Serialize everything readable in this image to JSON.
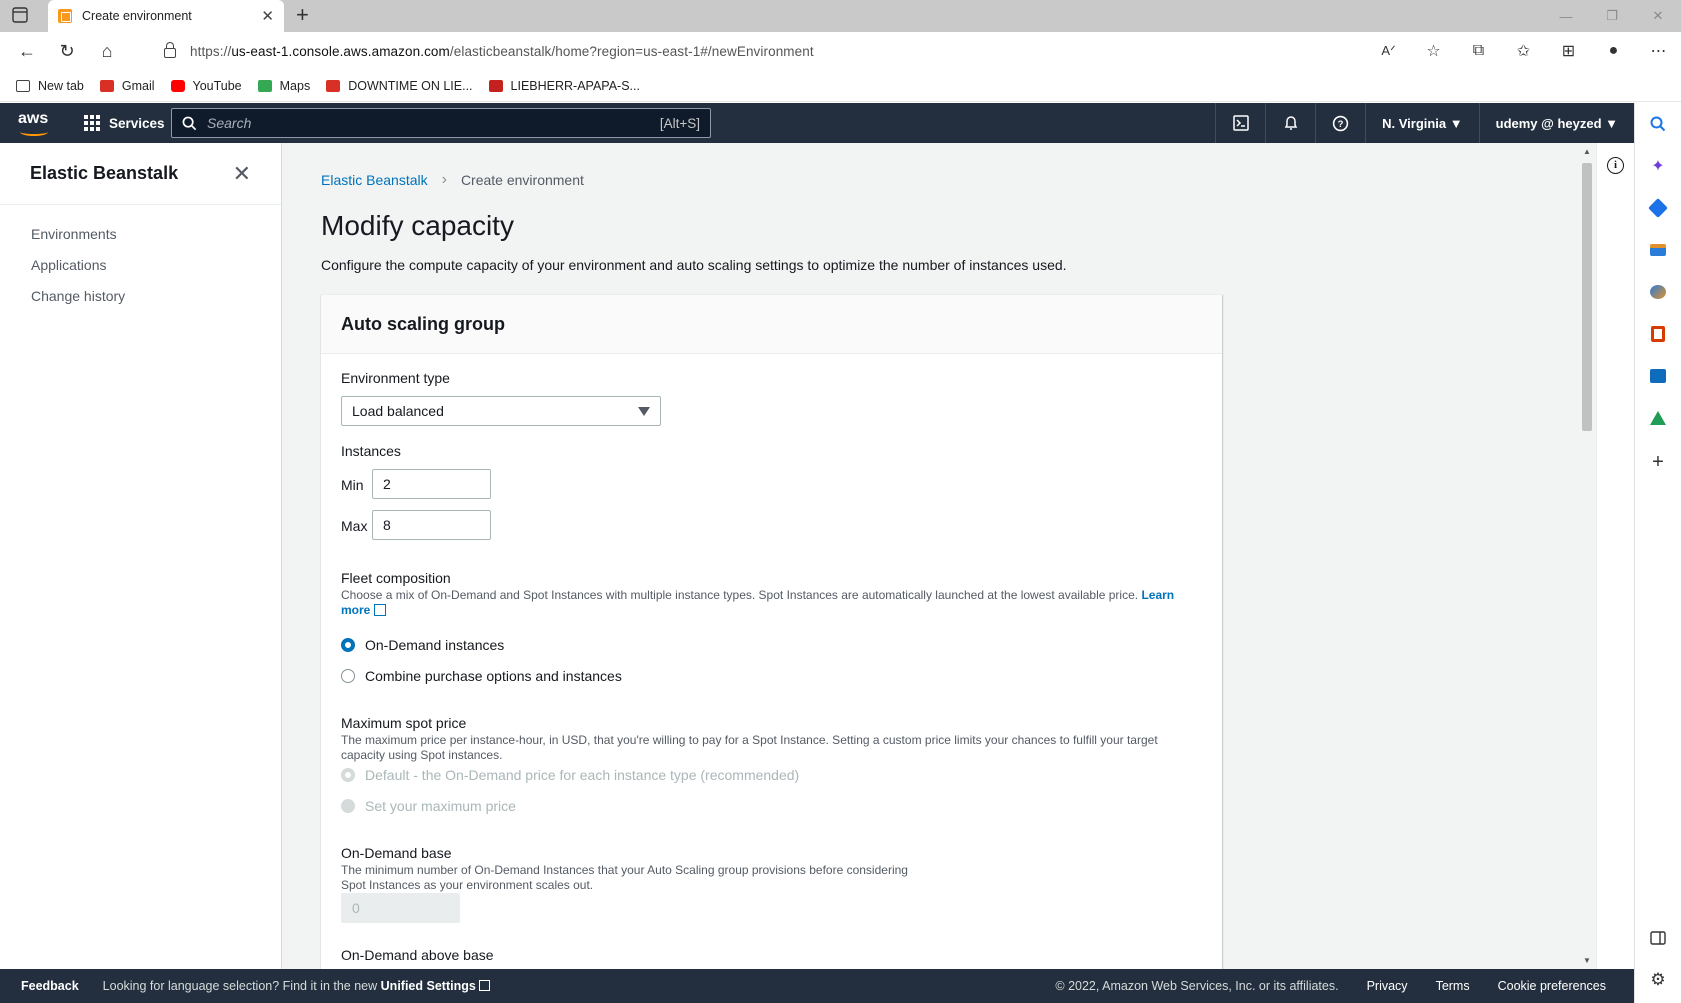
{
  "browser": {
    "tab_title": "Create environment",
    "url_prefix": "https://",
    "url_host": "us-east-1.console.aws.amazon.com",
    "url_path": "/elasticbeanstalk/home?region=us-east-1#/newEnvironment",
    "bookmarks": [
      {
        "label": "New tab",
        "color": "#444444"
      },
      {
        "label": "Gmail",
        "color": "#d93025"
      },
      {
        "label": "YouTube",
        "color": "#ff0000"
      },
      {
        "label": "Maps",
        "color": "#34a853"
      },
      {
        "label": "DOWNTIME ON LIE...",
        "color": "#d93025"
      },
      {
        "label": "LIEBHERR-APAPA-S...",
        "color": "#c5221f"
      }
    ]
  },
  "aws_nav": {
    "logo": "aws",
    "services_label": "Services",
    "search_placeholder": "Search",
    "search_shortcut": "[Alt+S]",
    "region": "N. Virginia ▼",
    "account": "udemy @ heyzed ▼"
  },
  "sidenav": {
    "title": "Elastic Beanstalk",
    "items": [
      "Environments",
      "Applications",
      "Change history"
    ]
  },
  "breadcrumb": {
    "parent": "Elastic Beanstalk",
    "current": "Create environment"
  },
  "page": {
    "title": "Modify capacity",
    "description": "Configure the compute capacity of your environment and auto scaling settings to optimize the number of instances used."
  },
  "asg": {
    "title": "Auto scaling group",
    "env_type_label": "Environment type",
    "env_type_value": "Load balanced",
    "instances_label": "Instances",
    "min_label": "Min",
    "min_value": "2",
    "max_label": "Max",
    "max_value": "8",
    "fleet_label": "Fleet composition",
    "fleet_desc": "Choose a mix of On-Demand and Spot Instances with multiple instance types. Spot Instances are automatically launched at the lowest available price.",
    "learn_more": "Learn more",
    "fleet_options": [
      "On-Demand instances",
      "Combine purchase options and instances"
    ],
    "spot_label": "Maximum spot price",
    "spot_desc": "The maximum price per instance-hour, in USD, that you're willing to pay for a Spot Instance. Setting a custom price limits your chances to fulfill your target capacity using Spot instances.",
    "spot_options": [
      "Default - the On-Demand price for each instance type (recommended)",
      "Set your maximum price"
    ],
    "od_base_label": "On-Demand base",
    "od_base_desc": "The minimum number of On-Demand Instances that your Auto Scaling group provisions before considering Spot Instances as your environment scales out.",
    "od_base_value": "0",
    "od_above_label": "On-Demand above base"
  },
  "footer": {
    "feedback": "Feedback",
    "language_msg": "Looking for language selection? Find it in the new",
    "unified_settings": "Unified Settings",
    "copyright": "© 2022, Amazon Web Services, Inc. or its affiliates.",
    "privacy": "Privacy",
    "terms": "Terms",
    "cookie": "Cookie preferences"
  },
  "colors": {
    "aws_nav_bg": "#232f3e",
    "link_blue": "#0073bb",
    "accent_orange": "#ff9900"
  }
}
